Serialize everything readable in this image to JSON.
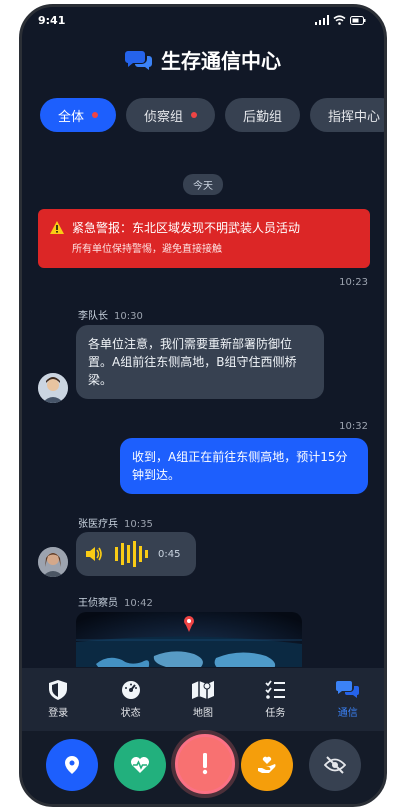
{
  "status_bar": {
    "time": "9:41"
  },
  "header": {
    "title": "生存通信中心"
  },
  "chips": [
    {
      "label": "全体",
      "unread": true
    },
    {
      "label": "侦察组",
      "unread": true
    },
    {
      "label": "后勤组",
      "unread": false
    },
    {
      "label": "指挥中心",
      "unread": false
    }
  ],
  "chat": {
    "date_separator": "今天",
    "alert": {
      "title": "紧急警报：东北区域发现不明武装人员活动",
      "subtitle": "所有单位保持警惕，避免直接接触",
      "time": "10:23"
    },
    "messages": [
      {
        "sender": "李队长",
        "time": "10:30",
        "text": "各单位注意，我们需要重新部署防御位置。A组前往东侧高地，B组守住西侧桥梁。"
      },
      {
        "sender": "",
        "time": "10:32",
        "text": "收到，A组正在前往东侧高地，预计15分钟到达。"
      },
      {
        "sender": "张医疗兵",
        "time": "10:35",
        "voice_duration": "0:45"
      },
      {
        "sender": "王侦察员",
        "time": "10:42"
      }
    ]
  },
  "bottom_nav": [
    {
      "label": "登录",
      "icon": "shield-icon"
    },
    {
      "label": "状态",
      "icon": "gauge-icon"
    },
    {
      "label": "地图",
      "icon": "map-icon"
    },
    {
      "label": "任务",
      "icon": "tasks-icon"
    },
    {
      "label": "通信",
      "icon": "chat-icon",
      "active": true
    }
  ],
  "actions": [
    {
      "name": "location",
      "icon": "location-pin-icon",
      "color": "#1d5ffd"
    },
    {
      "name": "health",
      "icon": "heartbeat-icon",
      "color": "#22b07d"
    },
    {
      "name": "emergency",
      "icon": "exclamation-icon",
      "color": "#f87171"
    },
    {
      "name": "supply",
      "icon": "hand-heart-icon",
      "color": "#f59e0b"
    },
    {
      "name": "stealth",
      "icon": "eye-slash-icon",
      "color": "#374151"
    }
  ]
}
